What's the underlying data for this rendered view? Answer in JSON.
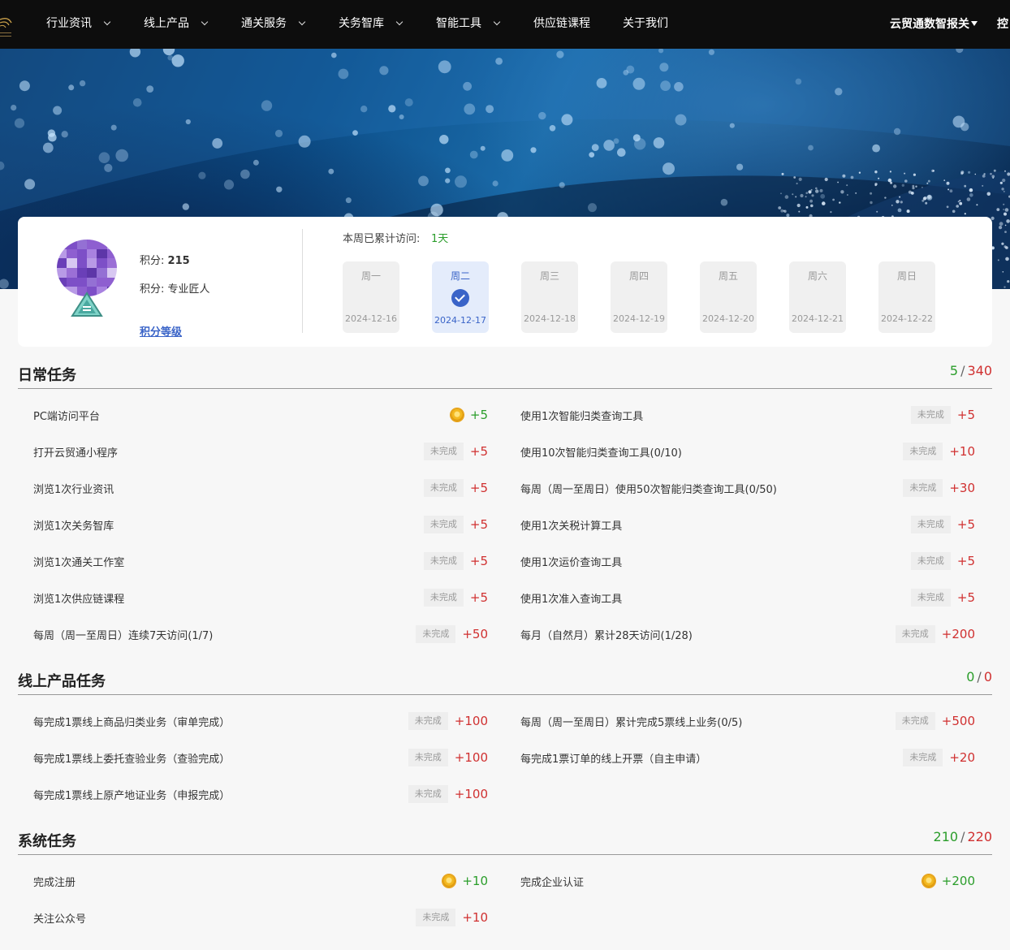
{
  "nav": {
    "items": [
      {
        "label": "行业资讯",
        "dropdown": true
      },
      {
        "label": "线上产品",
        "dropdown": true
      },
      {
        "label": "通关服务",
        "dropdown": true
      },
      {
        "label": "关务智库",
        "dropdown": true
      },
      {
        "label": "智能工具",
        "dropdown": true
      },
      {
        "label": "供应链课程",
        "dropdown": false
      },
      {
        "label": "关于我们",
        "dropdown": false
      }
    ],
    "user_menu": "云贸通数智报关",
    "extra": "控"
  },
  "profile": {
    "points_label": "积分:",
    "points_value": "215",
    "level_label": "积分:",
    "level_value": "专业匠人",
    "level_link": "积分等级",
    "visit_label": "本周已累计访问:",
    "visit_value": "1天"
  },
  "week": [
    {
      "name": "周一",
      "date": "2024-12-16",
      "checked": false
    },
    {
      "name": "周二",
      "date": "2024-12-17",
      "checked": true
    },
    {
      "name": "周三",
      "date": "2024-12-18",
      "checked": false
    },
    {
      "name": "周四",
      "date": "2024-12-19",
      "checked": false
    },
    {
      "name": "周五",
      "date": "2024-12-20",
      "checked": false
    },
    {
      "name": "周六",
      "date": "2024-12-21",
      "checked": false
    },
    {
      "name": "周日",
      "date": "2024-12-22",
      "checked": false
    }
  ],
  "status_incomplete": "未完成",
  "sections": {
    "daily": {
      "title": "日常任务",
      "earned": "5",
      "total": "340",
      "left": [
        {
          "name": "PC端访问平台",
          "points": "+5",
          "done": true
        },
        {
          "name": "打开云贸通小程序",
          "points": "+5",
          "done": false
        },
        {
          "name": "浏览1次行业资讯",
          "points": "+5",
          "done": false
        },
        {
          "name": "浏览1次关务智库",
          "points": "+5",
          "done": false
        },
        {
          "name": "浏览1次通关工作室",
          "points": "+5",
          "done": false
        },
        {
          "name": "浏览1次供应链课程",
          "points": "+5",
          "done": false
        },
        {
          "name": "每周（周一至周日）连续7天访问(1/7)",
          "points": "+50",
          "done": false
        }
      ],
      "right": [
        {
          "name": "使用1次智能归类查询工具",
          "points": "+5",
          "done": false
        },
        {
          "name": "使用10次智能归类查询工具(0/10)",
          "points": "+10",
          "done": false
        },
        {
          "name": "每周（周一至周日）使用50次智能归类查询工具(0/50)",
          "points": "+30",
          "done": false
        },
        {
          "name": "使用1次关税计算工具",
          "points": "+5",
          "done": false
        },
        {
          "name": "使用1次运价查询工具",
          "points": "+5",
          "done": false
        },
        {
          "name": "使用1次准入查询工具",
          "points": "+5",
          "done": false
        },
        {
          "name": "每月（自然月）累计28天访问(1/28)",
          "points": "+200",
          "done": false
        }
      ]
    },
    "online": {
      "title": "线上产品任务",
      "earned": "0",
      "total": "0",
      "left": [
        {
          "name": "每完成1票线上商品归类业务（审单完成）",
          "points": "+100",
          "done": false
        },
        {
          "name": "每完成1票线上委托查验业务（查验完成）",
          "points": "+100",
          "done": false
        },
        {
          "name": "每完成1票线上原产地证业务（申报完成）",
          "points": "+100",
          "done": false
        }
      ],
      "right": [
        {
          "name": "每周（周一至周日）累计完成5票线上业务(0/5)",
          "points": "+500",
          "done": false
        },
        {
          "name": "每完成1票订单的线上开票（自主申请）",
          "points": "+20",
          "done": false
        }
      ]
    },
    "system": {
      "title": "系统任务",
      "earned": "210",
      "total": "220",
      "left": [
        {
          "name": "完成注册",
          "points": "+10",
          "done": true
        },
        {
          "name": "关注公众号",
          "points": "+10",
          "done": false
        }
      ],
      "right": [
        {
          "name": "完成企业认证",
          "points": "+200",
          "done": true
        }
      ]
    }
  },
  "colors": {
    "done": "#2a9d2a",
    "pending": "#d03030",
    "accent": "#3a64c8"
  }
}
